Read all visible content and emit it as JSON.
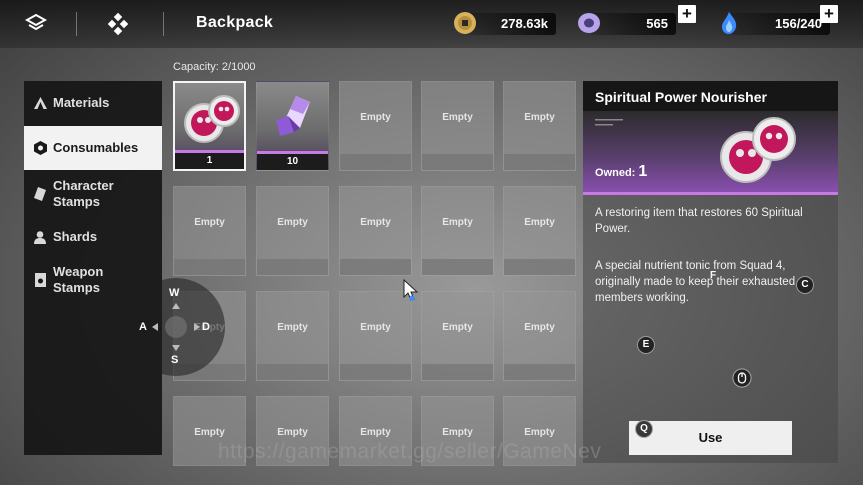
{
  "header": {
    "title": "Backpack",
    "icons": [
      "stack-icon",
      "diamond-grid-icon"
    ]
  },
  "currencies": [
    {
      "icon": "gold-coin-icon",
      "value": "278.63k",
      "has_plus": false
    },
    {
      "icon": "purple-ring-icon",
      "value": "565",
      "has_plus": true
    },
    {
      "icon": "blue-flame-icon",
      "value": "156/240",
      "has_plus": true
    }
  ],
  "plus_label": "+",
  "capacity": "Capacity: 2/1000",
  "sidebar": {
    "items": [
      {
        "label": "Materials",
        "icon": "triangles-icon",
        "active": false
      },
      {
        "label": "Consumables",
        "icon": "hexagon-icon",
        "active": true
      },
      {
        "label": "Character Stamps",
        "icon": "stamp-icon",
        "active": false
      },
      {
        "label": "Shards",
        "icon": "person-icon",
        "active": false
      },
      {
        "label": "Weapon Stamps",
        "icon": "card-icon",
        "active": false
      }
    ]
  },
  "grid": {
    "empty_label": "Empty",
    "items": [
      {
        "qty": "1",
        "icon": "skull-orbs-icon"
      },
      {
        "qty": "10",
        "icon": "purple-crystal-icon"
      }
    ]
  },
  "detail": {
    "title": "Spiritual Power Nourisher",
    "owned_label": "Owned:",
    "owned_value": "1",
    "desc1": "A restoring item that restores 60 Spiritual Power.",
    "desc2": "A special nutrient tonic from Squad 4, originally made to keep their exhausted members working.",
    "use_label": "Use"
  },
  "keys": {
    "c": "C",
    "f": "F",
    "e": "E",
    "q": "Q",
    "w": "W",
    "a": "A",
    "s": "S",
    "d": "D"
  },
  "watermark": "https://gamemarket.gg/seller/GameNev",
  "colors": {
    "accent_purple": "#c77ae6",
    "active_tab_bg": "#f2f2f2",
    "panel_dark": "#161616"
  }
}
